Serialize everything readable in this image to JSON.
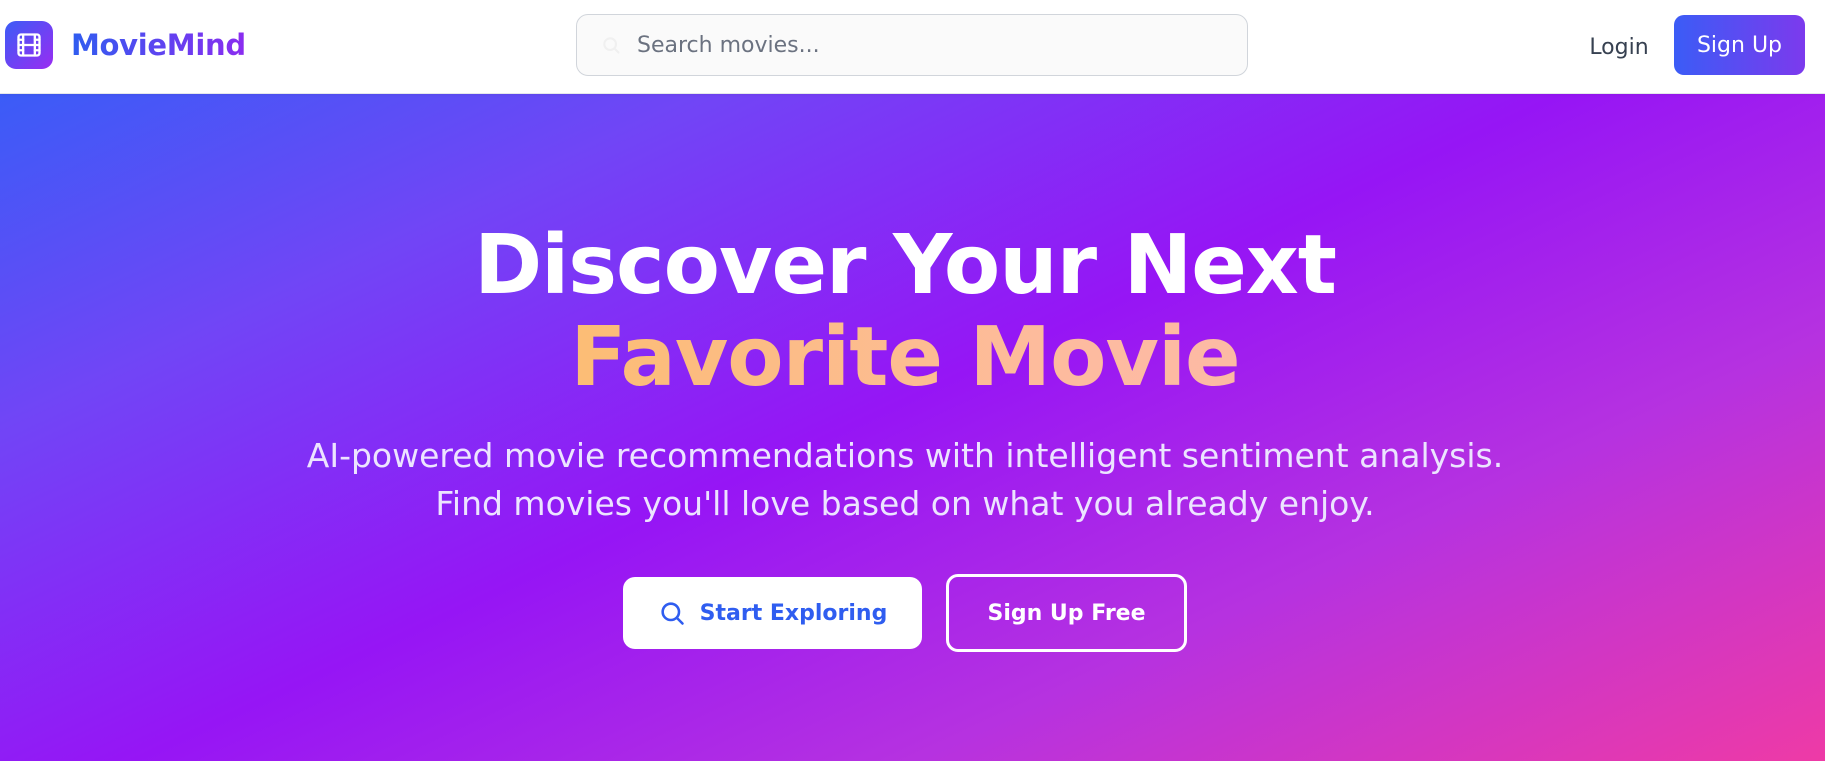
{
  "brand": {
    "name": "MovieMind",
    "logo_icon": "film-icon"
  },
  "search": {
    "placeholder": "Search movies...",
    "value": "",
    "icon": "search-icon"
  },
  "nav": {
    "login_label": "Login",
    "signup_label": "Sign Up"
  },
  "hero": {
    "title_line1": "Discover Your Next",
    "title_line2": "Favorite Movie",
    "subtitle_line1": "AI-powered movie recommendations with intelligent sentiment analysis.",
    "subtitle_line2": "Find movies you'll love based on what you already enjoy.",
    "primary_button": {
      "label": "Start Exploring",
      "icon": "search-icon"
    },
    "secondary_button": {
      "label": "Sign Up Free"
    }
  },
  "colors": {
    "brand_blue": "#2f5df0",
    "brand_purple": "#8b2cf0",
    "hero_start": "#3b5cf7",
    "hero_mid": "#9615f5",
    "hero_end": "#ee3aa6",
    "accent_gold": "#fbbf45"
  }
}
